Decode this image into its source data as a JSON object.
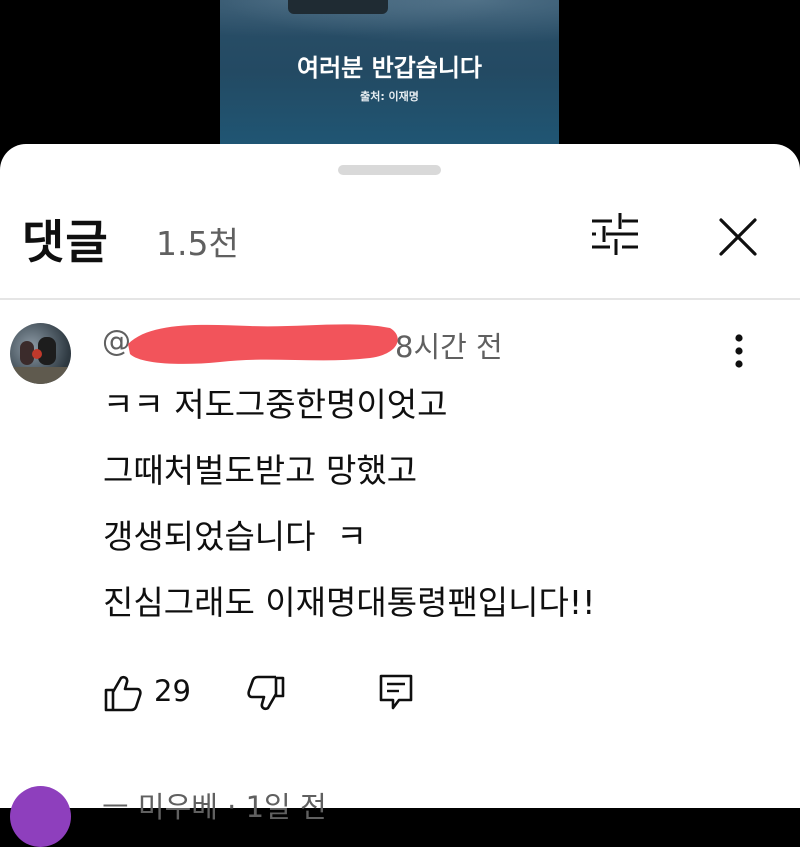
{
  "video": {
    "title": "여러분 반갑습니다",
    "source": "출처: 이재명"
  },
  "comments_panel": {
    "title": "댓글",
    "count": "1.5천",
    "filter_icon": "tune-sliders-icon",
    "close_icon": "close-x-icon"
  },
  "comment": {
    "handle": "@",
    "time": "8시간 전",
    "lines": [
      "ㅋㅋ 저도그중한명이엇고",
      "그때처벌도받고 망했고",
      "갱생되었습니다  ㅋ",
      "진심그래도 이재명대통령팬입니다!!"
    ],
    "likes": "29",
    "like_icon": "thumbs-up-icon",
    "dislike_icon": "thumbs-down-icon",
    "reply_icon": "reply-comment-icon",
    "more_icon": "more-vertical-icon"
  },
  "next_comment": {
    "meta": "ㅡ 미우베 · 1일 전",
    "avatar_color": "#8e3fbd"
  },
  "colors": {
    "redaction": "#f2545b",
    "secondary_text": "#606060",
    "primary_text": "#0f0f0f"
  }
}
